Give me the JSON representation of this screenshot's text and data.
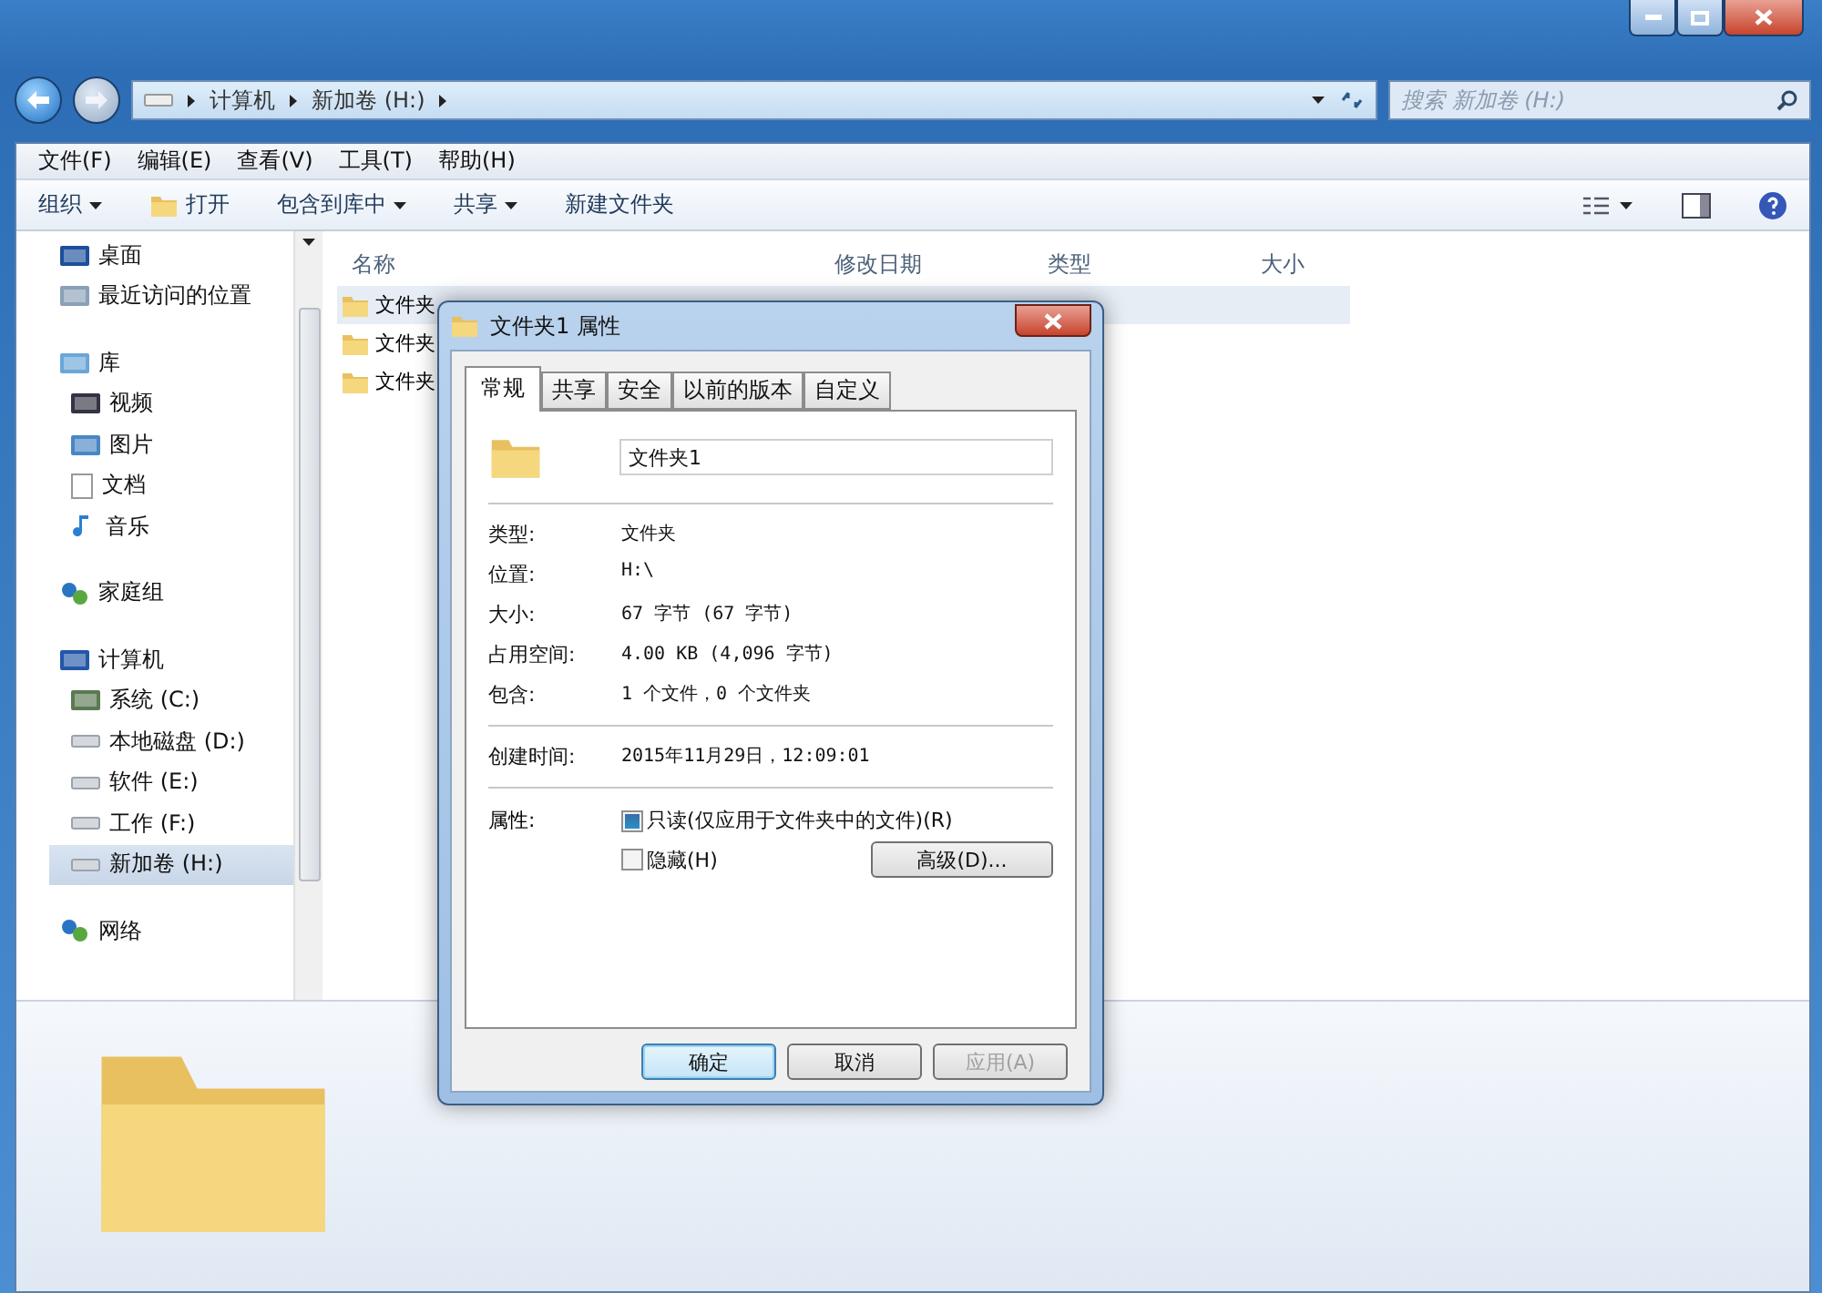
{
  "address_bar": {
    "path": [
      "计算机",
      "新加卷 (H:)"
    ],
    "search_placeholder": "搜索 新加卷 (H:)"
  },
  "menu": [
    "文件(F)",
    "编辑(E)",
    "查看(V)",
    "工具(T)",
    "帮助(H)"
  ],
  "toolbar": [
    {
      "label": "组织",
      "kind": "dropdown"
    },
    {
      "label": "打开",
      "kind": "icon"
    },
    {
      "label": "包含到库中",
      "kind": "dropdown"
    },
    {
      "label": "共享",
      "kind": "dropdown"
    },
    {
      "label": "新建文件夹",
      "kind": "plain"
    }
  ],
  "sidebar": [
    {
      "label": "桌面",
      "selected": false
    },
    {
      "label": "最近访问的位置",
      "selected": false
    },
    {
      "label": "库",
      "selected": false,
      "children": [
        {
          "label": "视频",
          "selected": false
        },
        {
          "label": "图片",
          "selected": false
        },
        {
          "label": "文档",
          "selected": false
        },
        {
          "label": "音乐",
          "selected": false
        }
      ]
    },
    {
      "label": "家庭组",
      "selected": false
    },
    {
      "label": "计算机",
      "selected": false,
      "children": [
        {
          "label": "系统 (C:)",
          "selected": false
        },
        {
          "label": "本地磁盘 (D:)",
          "selected": false
        },
        {
          "label": "软件 (E:)",
          "selected": false
        },
        {
          "label": "工作 (F:)",
          "selected": false
        },
        {
          "label": "新加卷 (H:)",
          "selected": true
        }
      ]
    },
    {
      "label": "网络",
      "selected": false
    }
  ],
  "table": {
    "columns": [
      "名称",
      "修改日期",
      "类型",
      "大小"
    ],
    "rows": [
      {
        "name": "文件夹",
        "selected": true
      },
      {
        "name": "文件夹",
        "selected": false
      },
      {
        "name": "文件夹",
        "selected": false
      }
    ]
  },
  "dialog": {
    "title": "文件夹1 属性",
    "tabs": [
      {
        "label": "常规",
        "selected": true
      },
      {
        "label": "共享",
        "selected": false
      },
      {
        "label": "安全",
        "selected": false
      },
      {
        "label": "以前的版本",
        "selected": false
      },
      {
        "label": "自定义",
        "selected": false
      }
    ],
    "name_value": "文件夹1",
    "sections": [
      [
        {
          "label": "类型:",
          "value": "文件夹"
        },
        {
          "label": "位置:",
          "value": "H:\\"
        },
        {
          "label": "大小:",
          "value": "67 字节 (67 字节)"
        },
        {
          "label": "占用空间:",
          "value": "4.00 KB (4,096 字节)"
        },
        {
          "label": "包含:",
          "value": "1 个文件，0 个文件夹"
        }
      ],
      [
        {
          "label": "创建时间:",
          "value": "2015年11月29日，12:09:01"
        }
      ]
    ],
    "attributes_label": "属性:",
    "attributes": [
      {
        "label": "只读(仅应用于文件夹中的文件)(R)",
        "checked": true
      },
      {
        "label": "隐藏(H)",
        "checked": false
      }
    ],
    "advanced_button": "高级(D)...",
    "buttons": [
      {
        "label": "确定",
        "kind": "default",
        "disabled": false
      },
      {
        "label": "取消",
        "kind": "normal",
        "disabled": false
      },
      {
        "label": "应用(A)",
        "kind": "normal",
        "disabled": true
      }
    ]
  }
}
